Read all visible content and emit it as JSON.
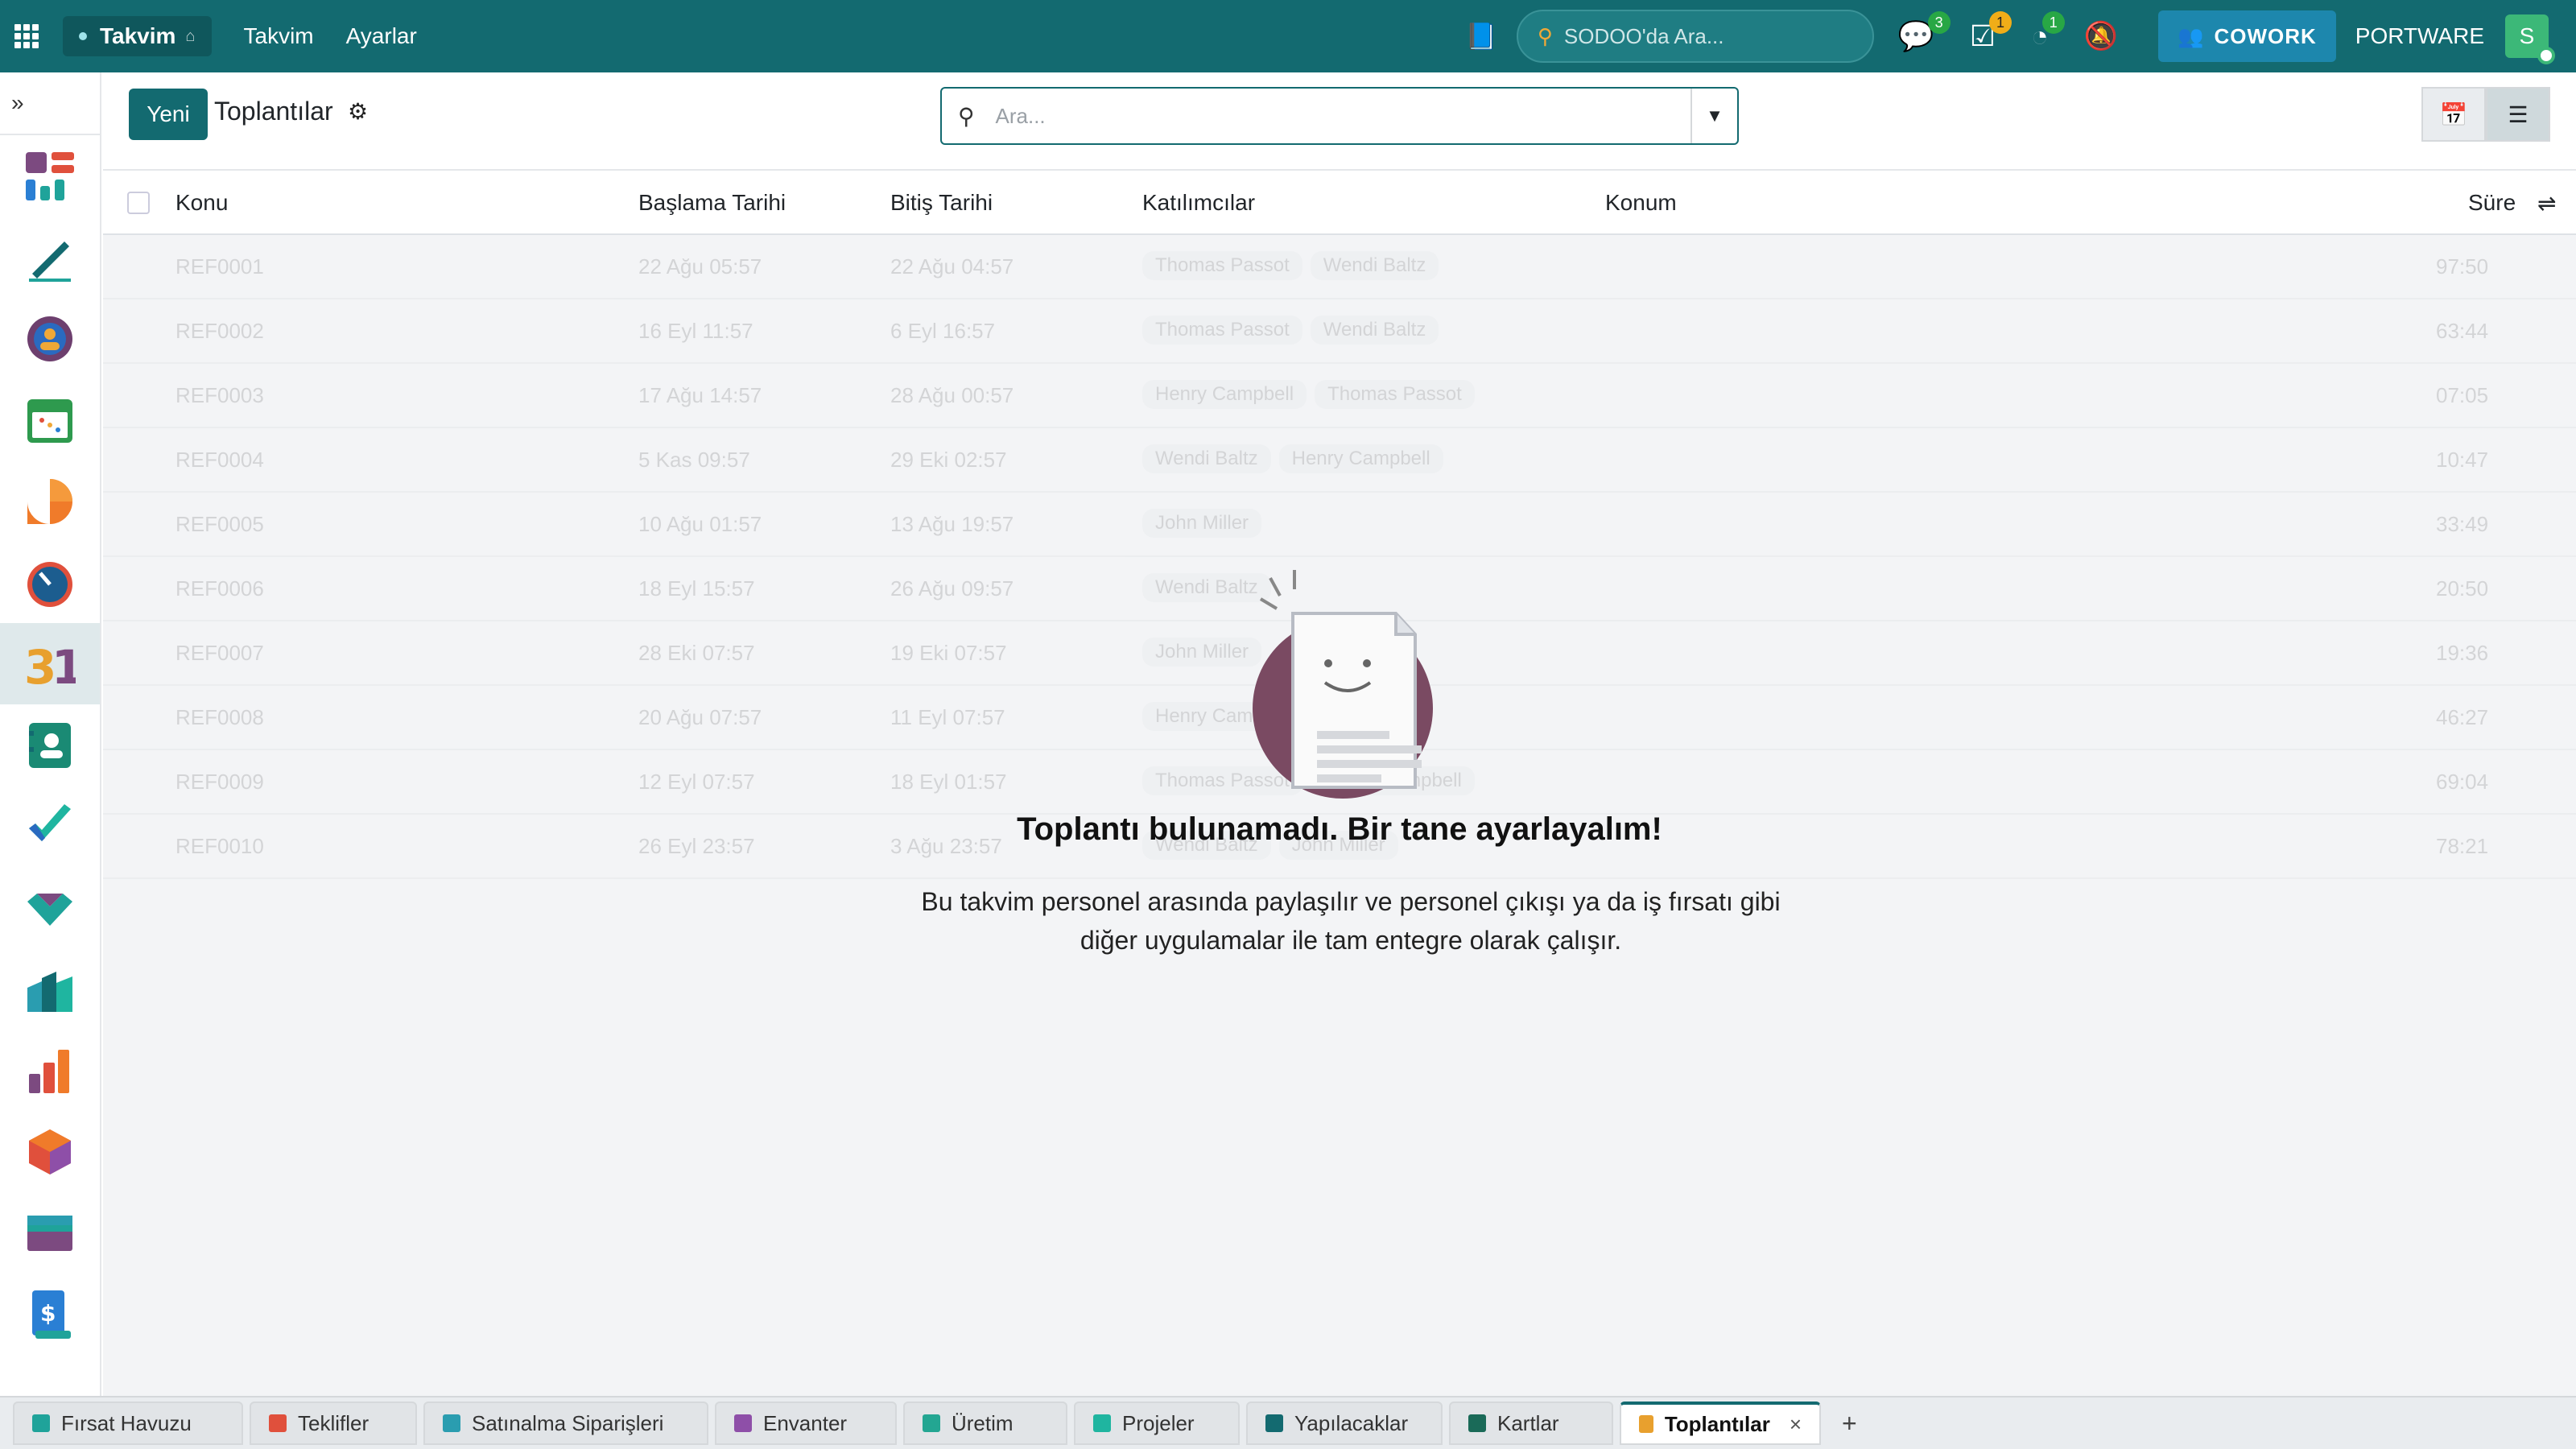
{
  "topbar": {
    "app_name": "Takvim",
    "menus": [
      "Takvim",
      "Ayarlar"
    ],
    "search_placeholder": "SODOO'da Ara...",
    "messages_count": "3",
    "activities_count": "1",
    "timers_count": "1",
    "cowork_label": "COWORK",
    "company": "PORTWARE",
    "avatar_letter": "S"
  },
  "control": {
    "new_label": "Yeni",
    "title": "Toplantılar",
    "search_placeholder": "Ara..."
  },
  "table": {
    "columns": [
      "Konu",
      "Başlama Tarihi",
      "Bitiş Tarihi",
      "Katılımcılar",
      "Konum",
      "Süre"
    ],
    "rows": [
      {
        "ref": "REF0001",
        "start": "22 Ağu 05:57",
        "end": "22 Ağu 04:57",
        "attendees": [
          "Thomas Passot",
          "Wendi Baltz"
        ],
        "duration": "97:50"
      },
      {
        "ref": "REF0002",
        "start": "16 Eyl 11:57",
        "end": "6 Eyl 16:57",
        "attendees": [
          "Thomas Passot",
          "Wendi Baltz"
        ],
        "duration": "63:44"
      },
      {
        "ref": "REF0003",
        "start": "17 Ağu 14:57",
        "end": "28 Ağu 00:57",
        "attendees": [
          "Henry Campbell",
          "Thomas Passot"
        ],
        "duration": "07:05"
      },
      {
        "ref": "REF0004",
        "start": "5 Kas 09:57",
        "end": "29 Eki 02:57",
        "attendees": [
          "Wendi Baltz",
          "Henry Campbell"
        ],
        "duration": "10:47"
      },
      {
        "ref": "REF0005",
        "start": "10 Ağu 01:57",
        "end": "13 Ağu 19:57",
        "attendees": [
          "John Miller"
        ],
        "duration": "33:49"
      },
      {
        "ref": "REF0006",
        "start": "18 Eyl 15:57",
        "end": "26 Ağu 09:57",
        "attendees": [
          "Wendi Baltz"
        ],
        "duration": "20:50"
      },
      {
        "ref": "REF0007",
        "start": "28 Eki 07:57",
        "end": "19 Eki 07:57",
        "attendees": [
          "John Miller"
        ],
        "duration": "19:36"
      },
      {
        "ref": "REF0008",
        "start": "20 Ağu 07:57",
        "end": "11 Eyl 07:57",
        "attendees": [
          "Henry Campbell"
        ],
        "duration": "46:27"
      },
      {
        "ref": "REF0009",
        "start": "12 Eyl 07:57",
        "end": "18 Eyl 01:57",
        "attendees": [
          "Thomas Passot",
          "Henry Campbell"
        ],
        "duration": "69:04"
      },
      {
        "ref": "REF0010",
        "start": "26 Eyl 23:57",
        "end": "3 Ağu 23:57",
        "attendees": [
          "Wendi Baltz",
          "John Miller"
        ],
        "duration": "78:21"
      }
    ]
  },
  "empty": {
    "title": "Toplantı bulunamadı. Bir tane ayarlayalım!",
    "text": "Bu takvim personel arasında paylaşılır ve personel çıkışı ya da iş fırsatı gibi diğer uygulamalar ile tam entegre olarak çalışır."
  },
  "tabs": [
    {
      "label": "Fırsat Havuzu",
      "color": "#1fa39a"
    },
    {
      "label": "Teklifler",
      "color": "#e0503c"
    },
    {
      "label": "Satınalma Siparişleri",
      "color": "#2a9db0"
    },
    {
      "label": "Envanter",
      "color": "#8e4fa8"
    },
    {
      "label": "Üretim",
      "color": "#23a692"
    },
    {
      "label": "Projeler",
      "color": "#1fb5a0"
    },
    {
      "label": "Yapılacaklar",
      "color": "#136a70"
    },
    {
      "label": "Kartlar",
      "color": "#1a6a58"
    },
    {
      "label": "Toplantılar",
      "color": "#e8a02e",
      "active": true
    }
  ],
  "accent_color": "#136a70"
}
